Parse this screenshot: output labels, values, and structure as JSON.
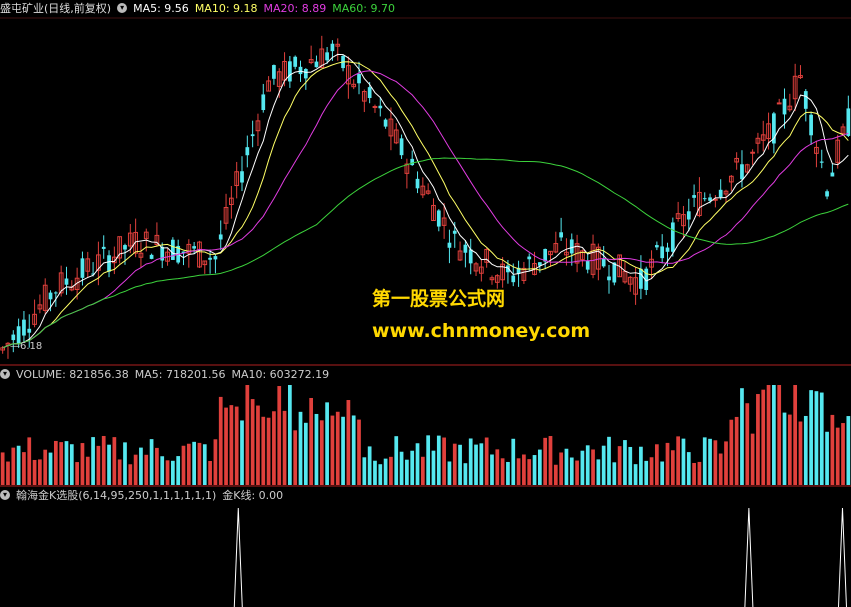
{
  "price_panel": {
    "stock_name": "盛屯矿业(日线,前复权)",
    "ma5": "MA5: 9.56",
    "ma10": "MA10: 9.18",
    "ma20": "MA20: 8.89",
    "ma60": "MA60: 9.70",
    "low_label": "6.18"
  },
  "volume_panel": {
    "volume": "VOLUME: 821856.38",
    "ma5": "MA5: 718201.56",
    "ma10": "MA10: 603272.19"
  },
  "indicator_panel": {
    "title": "翰海金K选股(6,14,95,250,1,1,1,1,1,1)",
    "value": "金K线: 0.00"
  },
  "watermark": {
    "line1": "第一股票公式网",
    "line2": "www.chnmoney.com"
  },
  "colors": {
    "up": "#e0403c",
    "down": "#55e8f0",
    "ma5": "#ffffff",
    "ma10": "#ffff66",
    "ma20": "#e03ce0",
    "ma60": "#3cd23c",
    "separator": "#b02020"
  },
  "indicator_spikes": [
    0.28,
    0.88,
    0.99
  ],
  "icons": [
    "dropdown-circle-icon"
  ]
}
